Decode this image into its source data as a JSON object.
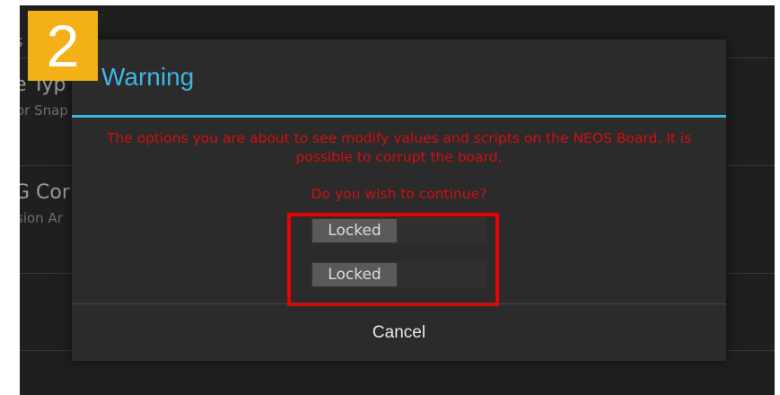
{
  "step": {
    "number": "2"
  },
  "background": {
    "header_fragment": "s",
    "items": [
      {
        "title_fragment": "e Typ",
        "subtitle_fragment": "or Snap"
      },
      {
        "title_fragment": "G Cor",
        "subtitle_fragment": "sion Ar"
      }
    ]
  },
  "dialog": {
    "title": "Warning",
    "message": "The options you are about to see modify values and scripts on the NEOS Board. It is possible to corrupt the board.",
    "question": "Do you wish to continue?",
    "toggles": [
      {
        "label": "Locked"
      },
      {
        "label": "Locked"
      }
    ],
    "cancel_label": "Cancel"
  },
  "colors": {
    "accent": "#3eb6e2",
    "warning_text": "#d01010",
    "highlight": "#ee0000",
    "badge": "#f3b117"
  }
}
